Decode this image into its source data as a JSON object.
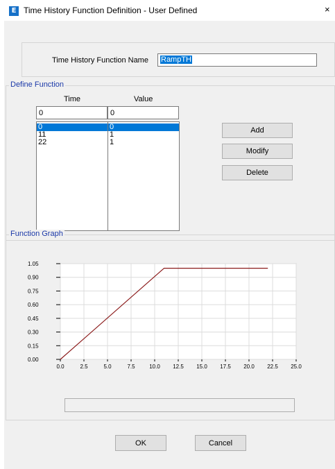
{
  "window": {
    "title": "Time History Function Definition  - User Defined",
    "app_icon_letter": "E",
    "close_glyph": "×"
  },
  "name_field": {
    "label": "Time History Function Name",
    "value": "RampTH"
  },
  "define_function": {
    "group_label": "Define Function",
    "col_time": "Time",
    "col_value": "Value",
    "time_input": "0",
    "value_input": "0",
    "rows": [
      {
        "time": "0",
        "value": "0",
        "selected": true
      },
      {
        "time": "11",
        "value": "1",
        "selected": false
      },
      {
        "time": "22",
        "value": "1",
        "selected": false
      }
    ],
    "buttons": {
      "add": "Add",
      "modify": "Modify",
      "delete": "Delete"
    }
  },
  "function_graph": {
    "group_label": "Function Graph"
  },
  "chart_data": {
    "type": "line",
    "x": [
      0,
      11,
      22
    ],
    "series": [
      {
        "values": [
          0,
          1,
          1
        ],
        "color": "#8b1a1a"
      }
    ],
    "xlim": [
      0,
      25
    ],
    "ylim": [
      0,
      1.05
    ],
    "x_ticks": [
      "0.0",
      "2.5",
      "5.0",
      "7.5",
      "10.0",
      "12.5",
      "15.0",
      "17.5",
      "20.0",
      "22.5",
      "25.0"
    ],
    "y_ticks": [
      "0.00",
      "0.15",
      "0.30",
      "0.45",
      "0.60",
      "0.75",
      "0.90",
      "1.05"
    ],
    "grid": true
  },
  "footer": {
    "ok": "OK",
    "cancel": "Cancel"
  }
}
